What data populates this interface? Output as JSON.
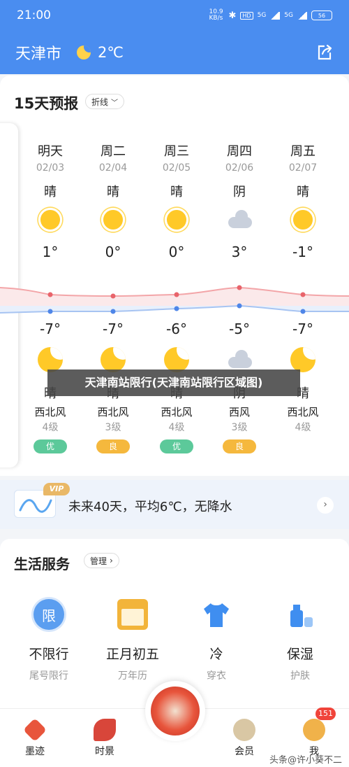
{
  "status": {
    "time": "21:00",
    "net_speed": "10.9 KB/s",
    "hd": "HD",
    "sig1": "5G",
    "sig2": "5G",
    "battery": "56"
  },
  "header": {
    "city": "天津市",
    "temperature": "2℃"
  },
  "forecast": {
    "title": "15天预报",
    "view_mode": "折线",
    "days": [
      {
        "name": "明天",
        "date": "02/03",
        "day_cond": "晴",
        "day_icon": "sun-icon",
        "high": "1°",
        "low": "-7°",
        "night_cond": "晴",
        "night_icon": "moon-icon",
        "wind_dir": "西北风",
        "wind_level": "4级",
        "aqi": "优",
        "aqi_color": "#5cc99a"
      },
      {
        "name": "周二",
        "date": "02/04",
        "day_cond": "晴",
        "day_icon": "sun-icon",
        "high": "0°",
        "low": "-7°",
        "night_cond": "晴",
        "night_icon": "moon-icon",
        "wind_dir": "西北风",
        "wind_level": "3级",
        "aqi": "良",
        "aqi_color": "#f5b83d"
      },
      {
        "name": "周三",
        "date": "02/05",
        "day_cond": "晴",
        "day_icon": "sun-icon",
        "high": "0°",
        "low": "-6°",
        "night_cond": "晴",
        "night_icon": "moon-icon",
        "wind_dir": "西北风",
        "wind_level": "4级",
        "aqi": "优",
        "aqi_color": "#5cc99a"
      },
      {
        "name": "周四",
        "date": "02/06",
        "day_cond": "阴",
        "day_icon": "cloud-icon",
        "high": "3°",
        "low": "-5°",
        "night_cond": "阴",
        "night_icon": "cloud-icon",
        "wind_dir": "西风",
        "wind_level": "3级",
        "aqi": "良",
        "aqi_color": "#f5b83d"
      },
      {
        "name": "周五",
        "date": "02/07",
        "day_cond": "晴",
        "day_icon": "sun-icon",
        "high": "-1°",
        "low": "-7°",
        "night_cond": "晴",
        "night_icon": "moon-icon",
        "wind_dir": "西北风",
        "wind_level": "4级",
        "aqi": "",
        "aqi_color": "#5cc99a"
      }
    ]
  },
  "banner": {
    "text": "天津南站限行(天津南站限行区域图)"
  },
  "vip": {
    "tag": "VIP",
    "text": "未来40天，平均6℃，无降水"
  },
  "life": {
    "title": "生活服务",
    "manage": "管理",
    "items": [
      {
        "name": "不限行",
        "sub": "尾号限行",
        "icon": "restriction-icon"
      },
      {
        "name": "正月初五",
        "sub": "万年历",
        "icon": "calendar-icon"
      },
      {
        "name": "冷",
        "sub": "穿衣",
        "icon": "tshirt-icon"
      },
      {
        "name": "保湿",
        "sub": "护肤",
        "icon": "lotion-icon"
      }
    ]
  },
  "tabs": [
    {
      "label": "墨迹",
      "icon": "moji-icon"
    },
    {
      "label": "时景",
      "icon": "fish-icon"
    },
    {
      "label": "会员",
      "icon": "tree-icon"
    },
    {
      "label": "我",
      "icon": "lion-icon"
    }
  ],
  "tab_badge": "151",
  "watermark": "头条@许小葵不二"
}
